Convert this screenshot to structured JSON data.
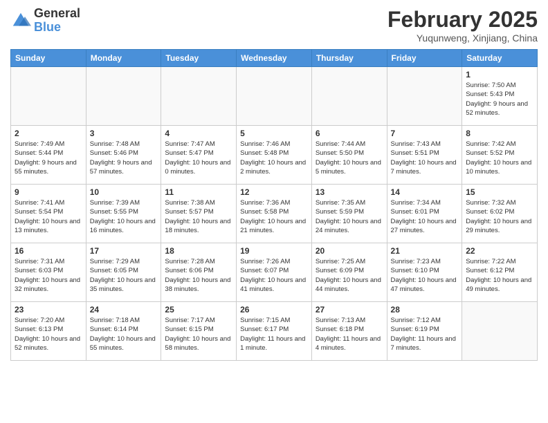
{
  "header": {
    "logo_general": "General",
    "logo_blue": "Blue",
    "month_title": "February 2025",
    "location": "Yuqunweng, Xinjiang, China"
  },
  "days_of_week": [
    "Sunday",
    "Monday",
    "Tuesday",
    "Wednesday",
    "Thursday",
    "Friday",
    "Saturday"
  ],
  "weeks": [
    [
      {
        "day": "",
        "info": ""
      },
      {
        "day": "",
        "info": ""
      },
      {
        "day": "",
        "info": ""
      },
      {
        "day": "",
        "info": ""
      },
      {
        "day": "",
        "info": ""
      },
      {
        "day": "",
        "info": ""
      },
      {
        "day": "1",
        "info": "Sunrise: 7:50 AM\nSunset: 5:43 PM\nDaylight: 9 hours and 52 minutes."
      }
    ],
    [
      {
        "day": "2",
        "info": "Sunrise: 7:49 AM\nSunset: 5:44 PM\nDaylight: 9 hours and 55 minutes."
      },
      {
        "day": "3",
        "info": "Sunrise: 7:48 AM\nSunset: 5:46 PM\nDaylight: 9 hours and 57 minutes."
      },
      {
        "day": "4",
        "info": "Sunrise: 7:47 AM\nSunset: 5:47 PM\nDaylight: 10 hours and 0 minutes."
      },
      {
        "day": "5",
        "info": "Sunrise: 7:46 AM\nSunset: 5:48 PM\nDaylight: 10 hours and 2 minutes."
      },
      {
        "day": "6",
        "info": "Sunrise: 7:44 AM\nSunset: 5:50 PM\nDaylight: 10 hours and 5 minutes."
      },
      {
        "day": "7",
        "info": "Sunrise: 7:43 AM\nSunset: 5:51 PM\nDaylight: 10 hours and 7 minutes."
      },
      {
        "day": "8",
        "info": "Sunrise: 7:42 AM\nSunset: 5:52 PM\nDaylight: 10 hours and 10 minutes."
      }
    ],
    [
      {
        "day": "9",
        "info": "Sunrise: 7:41 AM\nSunset: 5:54 PM\nDaylight: 10 hours and 13 minutes."
      },
      {
        "day": "10",
        "info": "Sunrise: 7:39 AM\nSunset: 5:55 PM\nDaylight: 10 hours and 16 minutes."
      },
      {
        "day": "11",
        "info": "Sunrise: 7:38 AM\nSunset: 5:57 PM\nDaylight: 10 hours and 18 minutes."
      },
      {
        "day": "12",
        "info": "Sunrise: 7:36 AM\nSunset: 5:58 PM\nDaylight: 10 hours and 21 minutes."
      },
      {
        "day": "13",
        "info": "Sunrise: 7:35 AM\nSunset: 5:59 PM\nDaylight: 10 hours and 24 minutes."
      },
      {
        "day": "14",
        "info": "Sunrise: 7:34 AM\nSunset: 6:01 PM\nDaylight: 10 hours and 27 minutes."
      },
      {
        "day": "15",
        "info": "Sunrise: 7:32 AM\nSunset: 6:02 PM\nDaylight: 10 hours and 29 minutes."
      }
    ],
    [
      {
        "day": "16",
        "info": "Sunrise: 7:31 AM\nSunset: 6:03 PM\nDaylight: 10 hours and 32 minutes."
      },
      {
        "day": "17",
        "info": "Sunrise: 7:29 AM\nSunset: 6:05 PM\nDaylight: 10 hours and 35 minutes."
      },
      {
        "day": "18",
        "info": "Sunrise: 7:28 AM\nSunset: 6:06 PM\nDaylight: 10 hours and 38 minutes."
      },
      {
        "day": "19",
        "info": "Sunrise: 7:26 AM\nSunset: 6:07 PM\nDaylight: 10 hours and 41 minutes."
      },
      {
        "day": "20",
        "info": "Sunrise: 7:25 AM\nSunset: 6:09 PM\nDaylight: 10 hours and 44 minutes."
      },
      {
        "day": "21",
        "info": "Sunrise: 7:23 AM\nSunset: 6:10 PM\nDaylight: 10 hours and 47 minutes."
      },
      {
        "day": "22",
        "info": "Sunrise: 7:22 AM\nSunset: 6:12 PM\nDaylight: 10 hours and 49 minutes."
      }
    ],
    [
      {
        "day": "23",
        "info": "Sunrise: 7:20 AM\nSunset: 6:13 PM\nDaylight: 10 hours and 52 minutes."
      },
      {
        "day": "24",
        "info": "Sunrise: 7:18 AM\nSunset: 6:14 PM\nDaylight: 10 hours and 55 minutes."
      },
      {
        "day": "25",
        "info": "Sunrise: 7:17 AM\nSunset: 6:15 PM\nDaylight: 10 hours and 58 minutes."
      },
      {
        "day": "26",
        "info": "Sunrise: 7:15 AM\nSunset: 6:17 PM\nDaylight: 11 hours and 1 minute."
      },
      {
        "day": "27",
        "info": "Sunrise: 7:13 AM\nSunset: 6:18 PM\nDaylight: 11 hours and 4 minutes."
      },
      {
        "day": "28",
        "info": "Sunrise: 7:12 AM\nSunset: 6:19 PM\nDaylight: 11 hours and 7 minutes."
      },
      {
        "day": "",
        "info": ""
      }
    ]
  ]
}
